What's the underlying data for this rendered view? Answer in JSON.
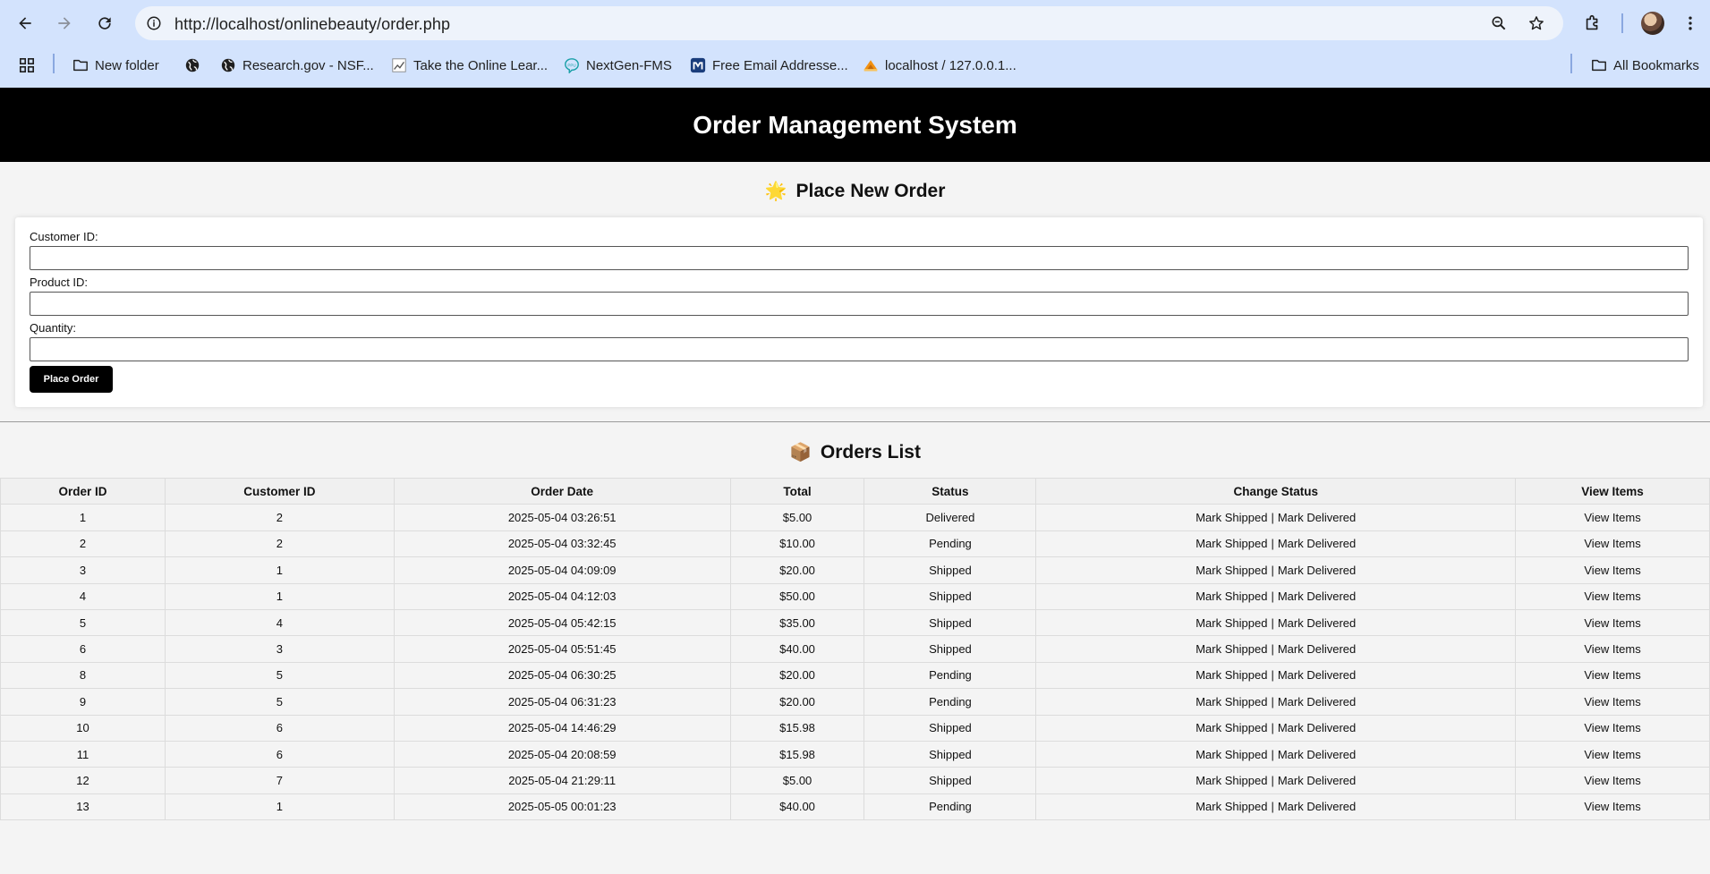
{
  "browser": {
    "url": "http://localhost/onlinebeauty/order.php",
    "bookmarks": [
      {
        "label": "New folder",
        "icon": "folder-icon"
      },
      {
        "label": "",
        "icon": "globe-icon"
      },
      {
        "label": "Research.gov - NSF...",
        "icon": "globe-icon"
      },
      {
        "label": "Take the Online Lear...",
        "icon": "chart-icon"
      },
      {
        "label": "NextGen-FMS",
        "icon": "ppu-icon"
      },
      {
        "label": "Free Email Addresse...",
        "icon": "m-icon"
      },
      {
        "label": "localhost / 127.0.0.1...",
        "icon": "pma-icon"
      }
    ],
    "all_bookmarks": "All Bookmarks"
  },
  "header": {
    "title": "Order Management System"
  },
  "new_order": {
    "icon": "🌟",
    "title": "Place New Order",
    "customer_label": "Customer ID:",
    "product_label": "Product ID:",
    "quantity_label": "Quantity:",
    "customer_value": "",
    "product_value": "",
    "quantity_value": "",
    "submit_label": "Place Order"
  },
  "orders": {
    "icon": "📦",
    "title": "Orders List",
    "columns": [
      "Order ID",
      "Customer ID",
      "Order Date",
      "Total",
      "Status",
      "Change Status",
      "View Items"
    ],
    "action_shipped": "Mark Shipped",
    "action_separator": "|",
    "action_delivered": "Mark Delivered",
    "view_label": "View Items",
    "rows": [
      {
        "id": "1",
        "customer": "2",
        "date": "2025-05-04 03:26:51",
        "total": "$5.00",
        "status": "Delivered"
      },
      {
        "id": "2",
        "customer": "2",
        "date": "2025-05-04 03:32:45",
        "total": "$10.00",
        "status": "Pending"
      },
      {
        "id": "3",
        "customer": "1",
        "date": "2025-05-04 04:09:09",
        "total": "$20.00",
        "status": "Shipped"
      },
      {
        "id": "4",
        "customer": "1",
        "date": "2025-05-04 04:12:03",
        "total": "$50.00",
        "status": "Shipped"
      },
      {
        "id": "5",
        "customer": "4",
        "date": "2025-05-04 05:42:15",
        "total": "$35.00",
        "status": "Shipped"
      },
      {
        "id": "6",
        "customer": "3",
        "date": "2025-05-04 05:51:45",
        "total": "$40.00",
        "status": "Shipped"
      },
      {
        "id": "8",
        "customer": "5",
        "date": "2025-05-04 06:30:25",
        "total": "$20.00",
        "status": "Pending"
      },
      {
        "id": "9",
        "customer": "5",
        "date": "2025-05-04 06:31:23",
        "total": "$20.00",
        "status": "Pending"
      },
      {
        "id": "10",
        "customer": "6",
        "date": "2025-05-04 14:46:29",
        "total": "$15.98",
        "status": "Shipped"
      },
      {
        "id": "11",
        "customer": "6",
        "date": "2025-05-04 20:08:59",
        "total": "$15.98",
        "status": "Shipped"
      },
      {
        "id": "12",
        "customer": "7",
        "date": "2025-05-04 21:29:11",
        "total": "$5.00",
        "status": "Shipped"
      },
      {
        "id": "13",
        "customer": "1",
        "date": "2025-05-05 00:01:23",
        "total": "$40.00",
        "status": "Pending"
      }
    ]
  }
}
